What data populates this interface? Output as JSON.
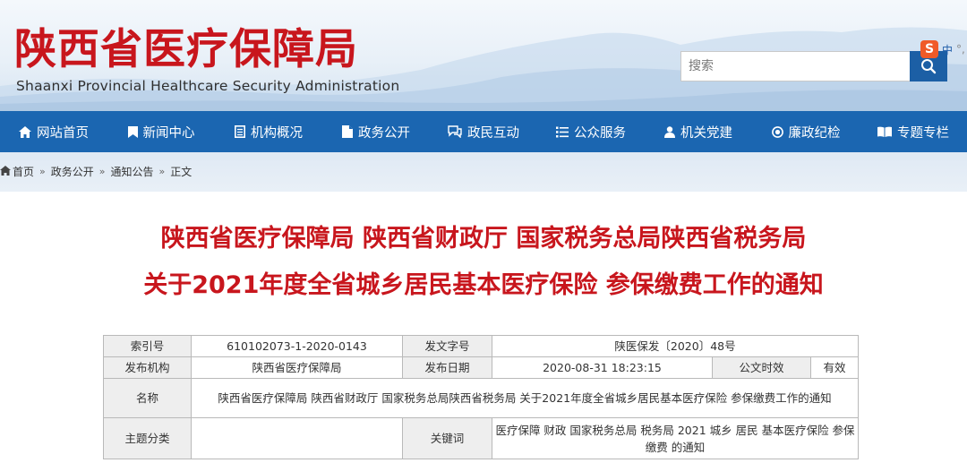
{
  "header": {
    "logo_cn": "陕西省医疗保障局",
    "logo_en": "Shaanxi Provincial Healthcare Security Administration",
    "search_placeholder": "搜索",
    "ime_label": "中",
    "ime_dot": "°,"
  },
  "nav": [
    {
      "label": "网站首页",
      "icon": "home-icon"
    },
    {
      "label": "新闻中心",
      "icon": "bookmark-icon"
    },
    {
      "label": "机构概况",
      "icon": "document-icon"
    },
    {
      "label": "政务公开",
      "icon": "file-icon"
    },
    {
      "label": "政民互动",
      "icon": "chat-icon"
    },
    {
      "label": "公众服务",
      "icon": "list-icon"
    },
    {
      "label": "机关党建",
      "icon": "user-icon"
    },
    {
      "label": "廉政纪检",
      "icon": "record-icon"
    },
    {
      "label": "专题专栏",
      "icon": "columns-icon"
    }
  ],
  "breadcrumb": [
    "首页",
    "政务公开",
    "通知公告",
    "正文"
  ],
  "breadcrumb_sep": "»",
  "article": {
    "title_line1": "陕西省医疗保障局 陕西省财政厅 国家税务总局陕西省税务局",
    "title_line2": "关于2021年度全省城乡居民基本医疗保险 参保缴费工作的通知"
  },
  "meta": {
    "index_label": "索引号",
    "index_value": "610102073-1-2020-0143",
    "docno_label": "发文字号",
    "docno_value": "陕医保发〔2020〕48号",
    "org_label": "发布机构",
    "org_value": "陕西省医疗保障局",
    "date_label": "发布日期",
    "date_value": "2020-08-31 18:23:15",
    "validity_label": "公文时效",
    "validity_value": "有效",
    "name_label": "名称",
    "name_value": "陕西省医疗保障局 陕西省财政厅 国家税务总局陕西省税务局 关于2021年度全省城乡居民基本医疗保险 参保缴费工作的通知",
    "topic_label": "主题分类",
    "topic_value": "",
    "keyword_label": "关键词",
    "keyword_value": "医疗保障 财政 国家税务总局 税务局 2021 城乡 居民 基本医疗保险 参保缴费 的通知"
  },
  "colors": {
    "brand_red": "#c8161d",
    "nav_blue": "#1b66b1",
    "search_blue": "#1c5fa5"
  }
}
